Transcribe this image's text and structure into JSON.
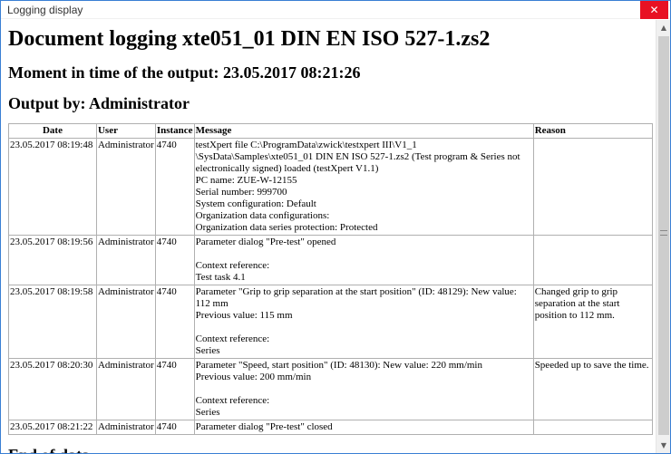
{
  "window": {
    "title": "Logging display",
    "close_glyph": "✕"
  },
  "document": {
    "heading": "Document logging xte051_01 DIN EN ISO 527-1.zs2",
    "moment": "Moment in time of the output: 23.05.2017 08:21:26",
    "output_by": "Output by: Administrator",
    "end": "End of data"
  },
  "table": {
    "headers": {
      "date": "Date",
      "user": "User",
      "instance": "Instance",
      "message": "Message",
      "reason": "Reason"
    },
    "rows": [
      {
        "date": "23.05.2017 08:19:48",
        "user": "Administrator",
        "instance": "4740",
        "message": [
          "testXpert file C:\\ProgramData\\zwick\\testxpert III\\V1_1",
          "\\SysData\\Samples\\xte051_01 DIN EN ISO 527-1.zs2 (Test program & Series not electronically signed) loaded (testXpert V1.1)",
          "PC name: ZUE-W-12155",
          "Serial number: 999700",
          "System configuration: Default",
          "Organization data configurations:",
          "Organization data series protection: Protected"
        ],
        "reason": ""
      },
      {
        "date": "23.05.2017 08:19:56",
        "user": "Administrator",
        "instance": "4740",
        "message": [
          "Parameter dialog \"Pre-test\" opened",
          "",
          "Context reference:",
          "Test task 4.1"
        ],
        "reason": ""
      },
      {
        "date": "23.05.2017 08:19:58",
        "user": "Administrator",
        "instance": "4740",
        "message": [
          "Parameter \"Grip to grip separation at the start position\" (ID: 48129): New value: 112 mm",
          "Previous value: 115 mm",
          "",
          "Context reference:",
          "Series"
        ],
        "reason": "Changed grip to grip separation at the start position to 112 mm."
      },
      {
        "date": "23.05.2017 08:20:30",
        "user": "Administrator",
        "instance": "4740",
        "message": [
          "Parameter \"Speed, start position\" (ID: 48130): New value: 220 mm/min",
          "Previous value: 200 mm/min",
          "",
          "Context reference:",
          "Series"
        ],
        "reason": "Speeded up to save the time."
      },
      {
        "date": "23.05.2017 08:21:22",
        "user": "Administrator",
        "instance": "4740",
        "message": [
          "Parameter dialog \"Pre-test\" closed"
        ],
        "reason": ""
      }
    ]
  },
  "scrollbar": {
    "up_glyph": "▲",
    "down_glyph": "▼"
  },
  "colors": {
    "close_button": "#e81123",
    "window_border": "#3a7fd4",
    "scroll_thumb": "#cdcdcd"
  }
}
